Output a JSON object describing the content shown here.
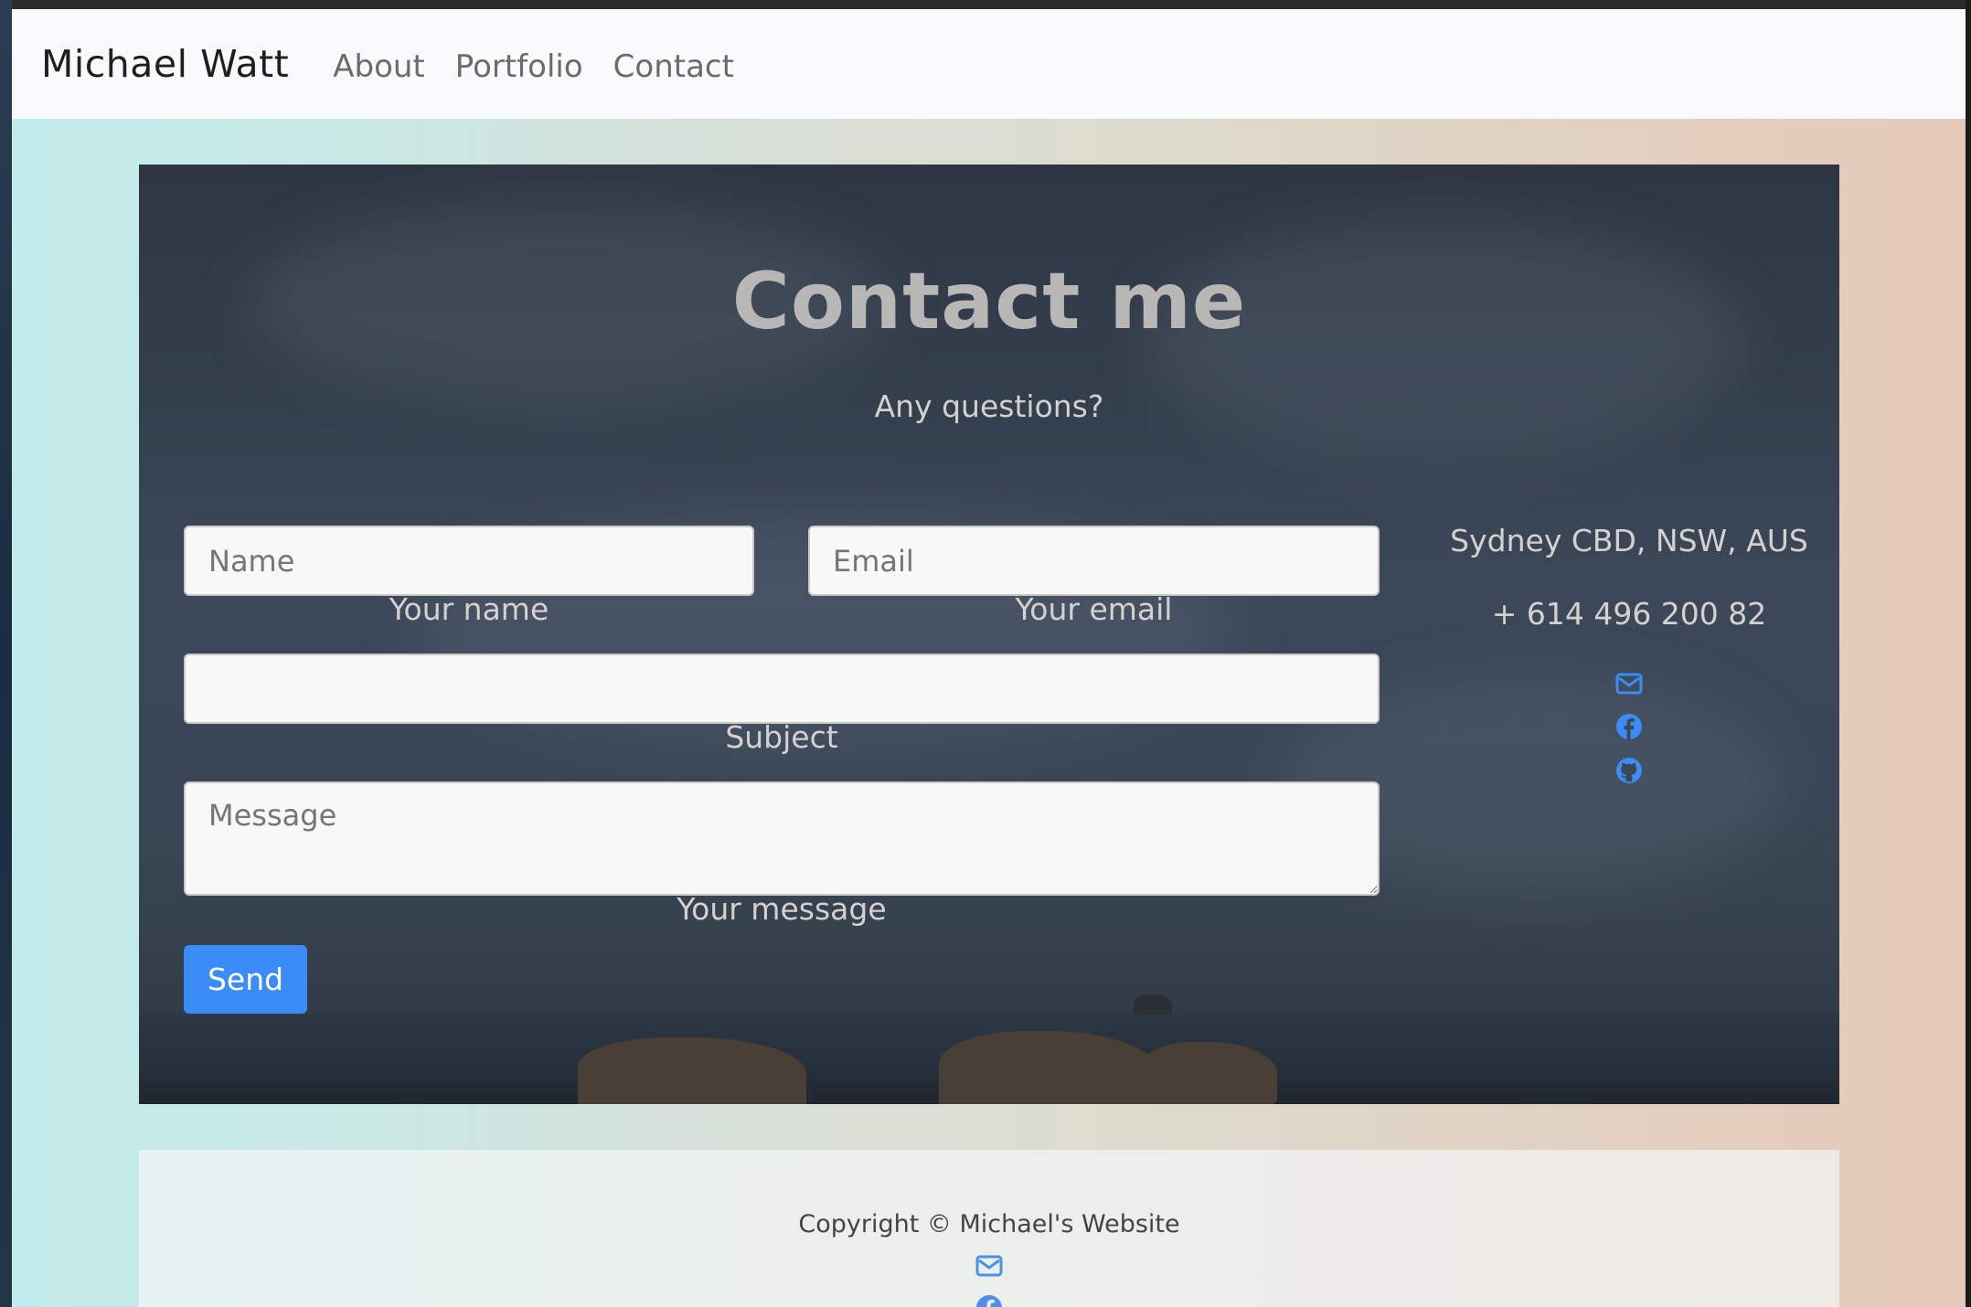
{
  "navbar": {
    "brand": "Michael Watt",
    "links": [
      "About",
      "Portfolio",
      "Contact"
    ]
  },
  "hero": {
    "title": "Contact me",
    "subtitle": "Any questions?"
  },
  "form": {
    "name_placeholder": "Name",
    "name_label": "Your name",
    "email_placeholder": "Email",
    "email_label": "Your email",
    "subject_placeholder": "",
    "subject_label": "Subject",
    "message_placeholder": "Message",
    "message_label": "Your message",
    "send_label": "Send"
  },
  "contact": {
    "location": "Sydney CBD, NSW, AUS",
    "phone": "+ 614 496 200 82",
    "icons": [
      "envelope-icon",
      "facebook-icon",
      "github-icon"
    ]
  },
  "footer": {
    "copyright": "Copyright © Michael's Website",
    "icons": [
      "envelope-icon",
      "facebook-icon"
    ]
  },
  "colors": {
    "accent": "#3b8cf6",
    "navbar_bg": "#f8f9fa",
    "hero_text": "#d4d1cf"
  }
}
